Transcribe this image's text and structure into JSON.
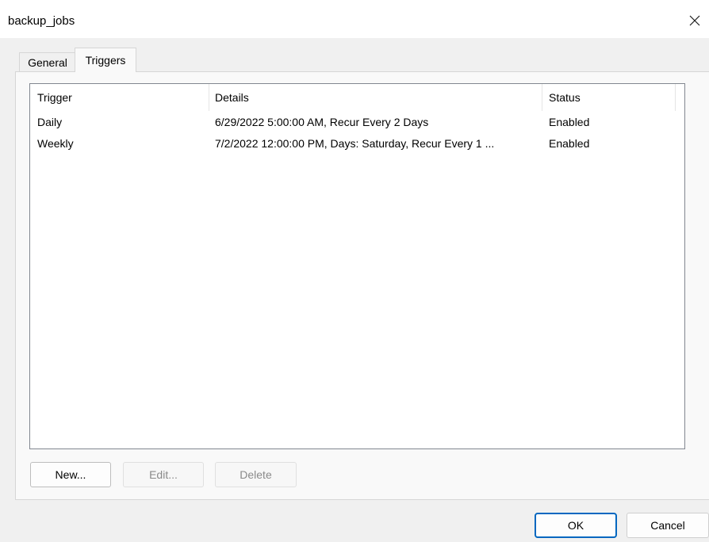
{
  "window": {
    "title": "backup_jobs",
    "close_icon": "close-icon"
  },
  "tabs": [
    {
      "label": "General",
      "selected": false
    },
    {
      "label": "Triggers",
      "selected": true
    }
  ],
  "triggers_table": {
    "columns": [
      "Trigger",
      "Details",
      "Status"
    ],
    "rows": [
      {
        "trigger": "Daily",
        "details": "6/29/2022 5:00:00 AM, Recur Every 2 Days",
        "status": "Enabled"
      },
      {
        "trigger": "Weekly",
        "details": "7/2/2022 12:00:00 PM, Days: Saturday, Recur Every 1 ...",
        "status": "Enabled"
      }
    ]
  },
  "actions": {
    "new_label": "New...",
    "edit_label": "Edit...",
    "delete_label": "Delete"
  },
  "footer": {
    "ok_label": "OK",
    "cancel_label": "Cancel"
  },
  "colors": {
    "accent": "#0067c0",
    "dialog_bg": "#f0f0f0",
    "panel_bg": "#f9f9f9",
    "disabled_text": "#8a8a8a"
  }
}
